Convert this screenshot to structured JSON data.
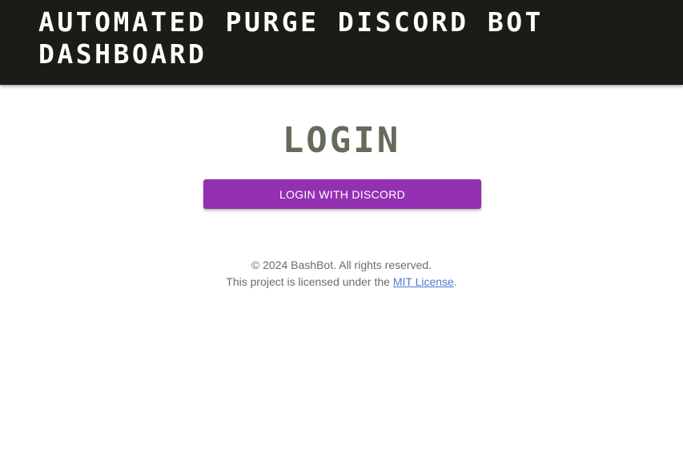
{
  "header": {
    "title": "AUTOMATED PURGE DISCORD BOT DASHBOARD"
  },
  "main": {
    "heading": "LOGIN",
    "login_button_label": "LOGIN WITH DISCORD"
  },
  "footer": {
    "copyright": "© 2024 BashBot. All rights reserved.",
    "license_prefix": "This project is licensed under the ",
    "license_link": "MIT License",
    "license_suffix": "."
  },
  "colors": {
    "header_bg": "#1b1c16",
    "button_bg": "#9430b2",
    "heading": "#636b5a",
    "link": "#4b7ad0"
  }
}
